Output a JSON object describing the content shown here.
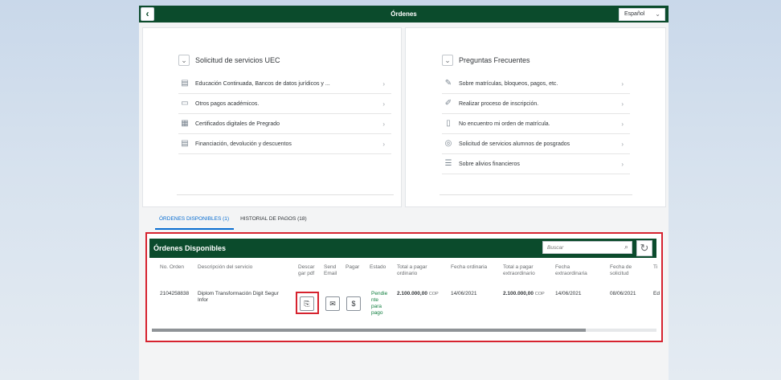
{
  "header": {
    "title": "Órdenes",
    "back_icon": "chevron-left-icon",
    "language": "Español"
  },
  "left_panel": {
    "title": "Solicitud de servicios UEC",
    "items": [
      {
        "label": "Educación Continuada, Bancos de datos jurídicos y ...",
        "icon": "document-icon"
      },
      {
        "label": "Otros pagos académicos.",
        "icon": "payment-icon"
      },
      {
        "label": "Certificados digitales de Pregrado",
        "icon": "certificate-icon"
      },
      {
        "label": "Financiación, devolución y descuentos",
        "icon": "document-icon"
      }
    ]
  },
  "right_panel": {
    "title": "Preguntas Frecuentes",
    "items": [
      {
        "label": "Sobre matrículas, bloqueos, pagos, etc.",
        "icon": "chat-icon"
      },
      {
        "label": "Realizar proceso de inscripción.",
        "icon": "edit-icon"
      },
      {
        "label": "No encuentro mi orden de matrícula.",
        "icon": "document-icon"
      },
      {
        "label": "Solicitud de servicios alumnos de posgrados",
        "icon": "service-icon"
      },
      {
        "label": "Sobre alivios financieros",
        "icon": "list-icon"
      }
    ]
  },
  "tabs": [
    {
      "label": "ÓRDENES DISPONIBLES (1)",
      "active": true
    },
    {
      "label": "HISTORIAL DE PAGOS (18)",
      "active": false
    }
  ],
  "orders": {
    "title": "Órdenes Disponibles",
    "search_placeholder": "Buscar",
    "columns": {
      "no_orden": "No. Orden",
      "descripcion": "Descripción del servicio",
      "descargar": [
        "Descar",
        "gar pdf"
      ],
      "send": [
        "Send",
        "Email"
      ],
      "pagar": "Pagar",
      "estado": "Estado",
      "total_ordinario": [
        "Total a pagar",
        "ordinario"
      ],
      "fecha_ordinaria": "Fecha ordinaria",
      "total_extra": [
        "Total a pagar",
        "extraordinario"
      ],
      "fecha_extra": [
        "Fecha",
        "extraordinaria"
      ],
      "fecha_solicitud": [
        "Fecha de",
        "solicitud"
      ],
      "tipo": "Ti"
    },
    "row": {
      "no_orden": "2104258838",
      "descripcion": [
        "Diplom Transformación Digit Segur",
        "Infor"
      ],
      "estado": [
        "Pendie",
        "nte",
        "para",
        "pago"
      ],
      "total_ordinario": "2.100.000,00",
      "moneda": "COP",
      "fecha_ordinaria": "14/06/2021",
      "total_extra": "2.100.000,00",
      "fecha_extra": "14/06/2021",
      "fecha_solicitud": "08/06/2021",
      "tipo": "Ed"
    },
    "scroll_fraction": 0.86
  },
  "colors": {
    "brand_green": "#0b4b2c",
    "highlight_red": "#d6232f",
    "tab_blue": "#0a6ed1",
    "status_green": "#107e3e"
  }
}
